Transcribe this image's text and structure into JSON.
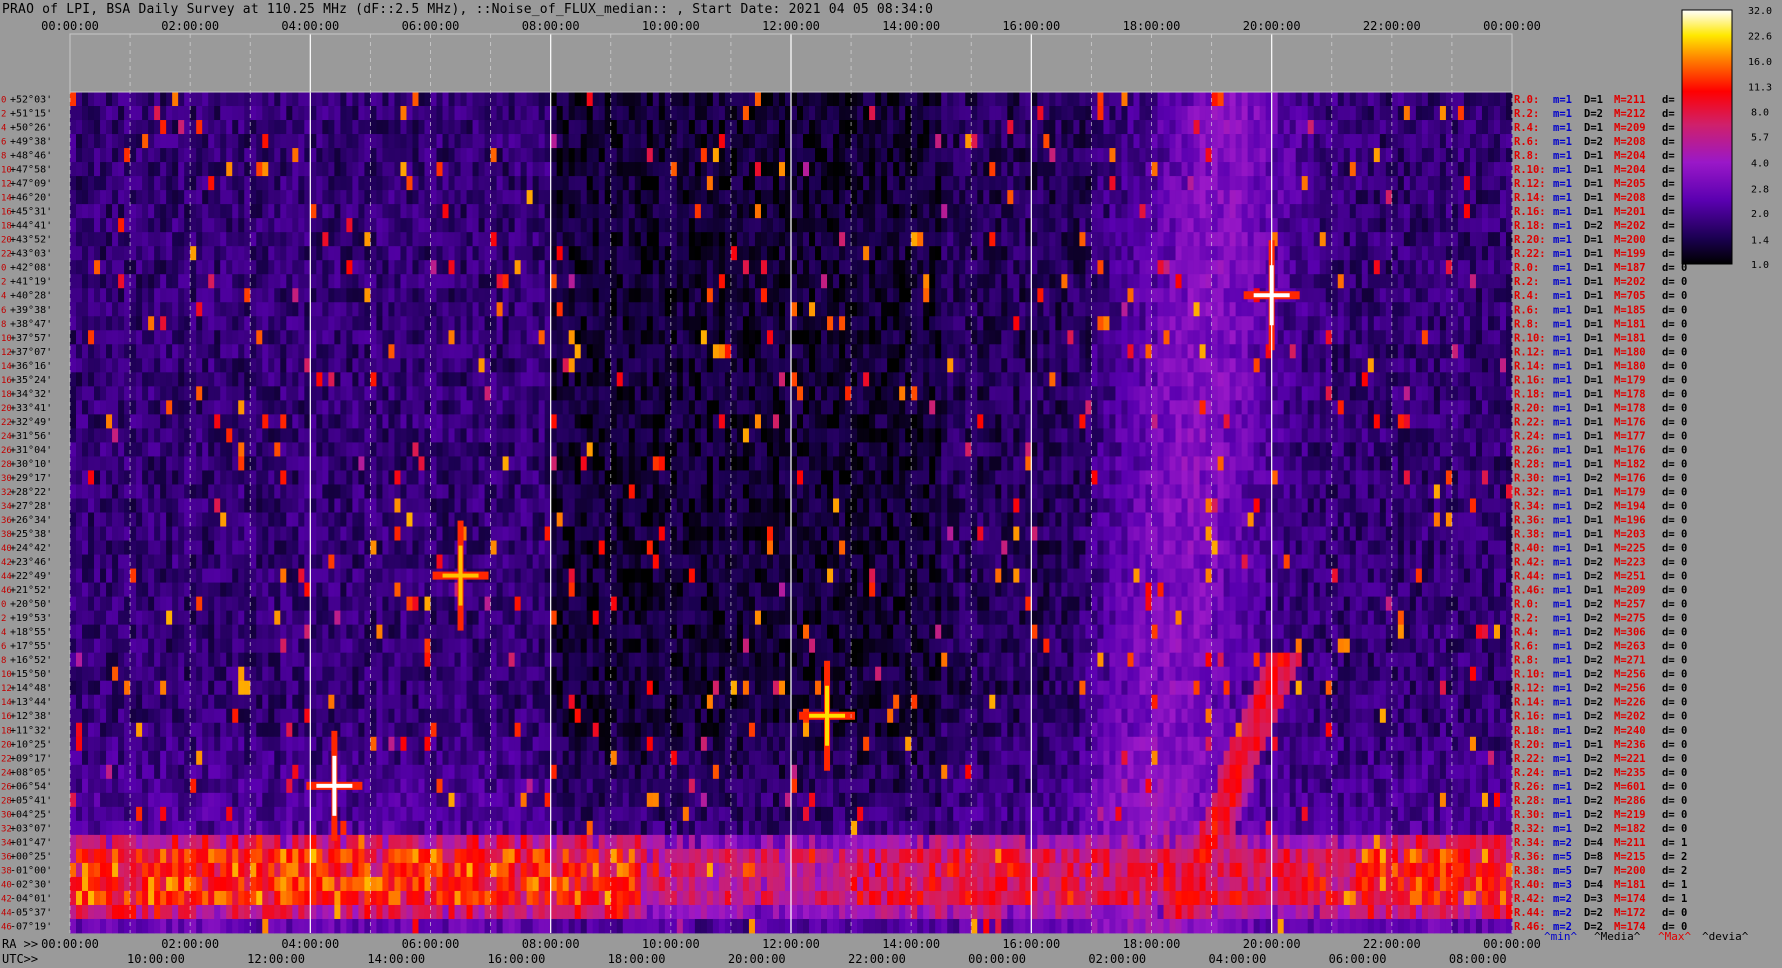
{
  "title": "PRAO of LPI, BSA Daily Survey at 110.25 MHz (dF::2.5 MHz), ::Noise_of_FLUX_median:: , Start Date: 2021 04 05 08:34:0",
  "chart_data": {
    "type": "heatmap",
    "title": "PRAO of LPI, BSA Daily Survey at 110.25 MHz (dF::2.5 MHz), ::Noise_of_FLUX_median:: , Start Date: 2021 04 05 08:34:0",
    "x_axis_top_ticks": [
      "00:00:00",
      "02:00:00",
      "04:00:00",
      "06:00:00",
      "08:00:00",
      "10:00:00",
      "12:00:00",
      "14:00:00",
      "16:00:00",
      "18:00:00",
      "20:00:00",
      "22:00:00",
      "00:00:00"
    ],
    "x_axis_bottom_ra_prefix": "RA >>",
    "x_axis_bottom_ra_ticks": [
      "00:00:00",
      "02:00:00",
      "04:00:00",
      "06:00:00",
      "08:00:00",
      "10:00:00",
      "12:00:00",
      "14:00:00",
      "16:00:00",
      "18:00:00",
      "20:00:00",
      "22:00:00",
      "00:00:00"
    ],
    "x_axis_bottom_utc_prefix": "UTC>>",
    "x_axis_bottom_utc_ticks": [
      "10:00:00",
      "12:00:00",
      "14:00:00",
      "16:00:00",
      "18:00:00",
      "20:00:00",
      "22:00:00",
      "00:00:00",
      "02:00:00",
      "04:00:00",
      "06:00:00",
      "08:00:00"
    ],
    "y_declinations": [
      "+52°03'",
      "+51°15'",
      "+50°26'",
      "+49°38'",
      "+48°46'",
      "+47°58'",
      "+47°09'",
      "+46°20'",
      "+45°31'",
      "+44°41'",
      "+43°52'",
      "+43°03'",
      "+42°08'",
      "+41°19'",
      "+40°28'",
      "+39°38'",
      "+38°47'",
      "+37°57'",
      "+37°07'",
      "+36°16'",
      "+35°24'",
      "+34°32'",
      "+33°41'",
      "+32°49'",
      "+31°56'",
      "+31°04'",
      "+30°10'",
      "+29°17'",
      "+28°22'",
      "+27°28'",
      "+26°34'",
      "+25°38'",
      "+24°42'",
      "+23°46'",
      "+22°49'",
      "+21°52'",
      "+20°50'",
      "+19°53'",
      "+18°55'",
      "+17°55'",
      "+16°52'",
      "+15°50'",
      "+14°48'",
      "+13°44'",
      "+12°38'",
      "+11°32'",
      "+10°25'",
      "+09°17'",
      "+08°05'",
      "+06°54'",
      "+05°41'",
      "+04°25'",
      "+03°07'",
      "+01°47'",
      "+00°25'",
      "-01°00'",
      "-02°30'",
      "-04°01'",
      "-05°37'",
      "-07°19'"
    ],
    "row_numbers": [
      "0",
      "2",
      "4",
      "6",
      "8",
      "10",
      "12",
      "14",
      "16",
      "18",
      "20",
      "22",
      "0",
      "2",
      "4",
      "6",
      "8",
      "10",
      "12",
      "14",
      "16",
      "18",
      "20",
      "22",
      "24",
      "26",
      "28",
      "30",
      "32",
      "34",
      "36",
      "38",
      "40",
      "42",
      "44",
      "46",
      "0",
      "2",
      "4",
      "6",
      "8",
      "10",
      "12",
      "14",
      "16",
      "18",
      "20",
      "22",
      "24",
      "26",
      "28",
      "30",
      "32",
      "34",
      "36",
      "38",
      "40",
      "42",
      "44",
      "46"
    ],
    "right_stats": [
      {
        "r": "R.0:",
        "m": "m=1",
        "d": "D=1",
        "M": "M=211",
        "dd": "d= 0"
      },
      {
        "r": "R.2:",
        "m": "m=1",
        "d": "D=2",
        "M": "M=212",
        "dd": "d= 0"
      },
      {
        "r": "R.4:",
        "m": "m=1",
        "d": "D=1",
        "M": "M=209",
        "dd": "d= 0"
      },
      {
        "r": "R.6:",
        "m": "m=1",
        "d": "D=2",
        "M": "M=208",
        "dd": "d= 0"
      },
      {
        "r": "R.8:",
        "m": "m=1",
        "d": "D=1",
        "M": "M=204",
        "dd": "d= 0"
      },
      {
        "r": "R.10:",
        "m": "m=1",
        "d": "D=1",
        "M": "M=204",
        "dd": "d="
      },
      {
        "r": "R.12:",
        "m": "m=1",
        "d": "D=1",
        "M": "M=205",
        "dd": "d="
      },
      {
        "r": "R.14:",
        "m": "m=1",
        "d": "D=1",
        "M": "M=208",
        "dd": "d="
      },
      {
        "r": "R.16:",
        "m": "m=1",
        "d": "D=1",
        "M": "M=201",
        "dd": "d="
      },
      {
        "r": "R.18:",
        "m": "m=1",
        "d": "D=2",
        "M": "M=202",
        "dd": "d="
      },
      {
        "r": "R.20:",
        "m": "m=1",
        "d": "D=1",
        "M": "M=200",
        "dd": "d="
      },
      {
        "r": "R.22:",
        "m": "m=1",
        "d": "D=1",
        "M": "M=199",
        "dd": "d="
      },
      {
        "r": "R.0:",
        "m": "m=1",
        "d": "D=1",
        "M": "M=187",
        "dd": "d= 0"
      },
      {
        "r": "R.2:",
        "m": "m=1",
        "d": "D=1",
        "M": "M=202",
        "dd": "d= 0"
      },
      {
        "r": "R.4:",
        "m": "m=1",
        "d": "D=1",
        "M": "M=705",
        "dd": "d= 0"
      },
      {
        "r": "R.6:",
        "m": "m=1",
        "d": "D=1",
        "M": "M=185",
        "dd": "d= 0"
      },
      {
        "r": "R.8:",
        "m": "m=1",
        "d": "D=1",
        "M": "M=181",
        "dd": "d= 0"
      },
      {
        "r": "R.10:",
        "m": "m=1",
        "d": "D=1",
        "M": "M=181",
        "dd": "d= 0"
      },
      {
        "r": "R.12:",
        "m": "m=1",
        "d": "D=1",
        "M": "M=180",
        "dd": "d= 0"
      },
      {
        "r": "R.14:",
        "m": "m=1",
        "d": "D=1",
        "M": "M=180",
        "dd": "d= 0"
      },
      {
        "r": "R.16:",
        "m": "m=1",
        "d": "D=1",
        "M": "M=179",
        "dd": "d= 0"
      },
      {
        "r": "R.18:",
        "m": "m=1",
        "d": "D=1",
        "M": "M=178",
        "dd": "d= 0"
      },
      {
        "r": "R.20:",
        "m": "m=1",
        "d": "D=1",
        "M": "M=178",
        "dd": "d= 0"
      },
      {
        "r": "R.22:",
        "m": "m=1",
        "d": "D=1",
        "M": "M=176",
        "dd": "d= 0"
      },
      {
        "r": "R.24:",
        "m": "m=1",
        "d": "D=1",
        "M": "M=177",
        "dd": "d= 0"
      },
      {
        "r": "R.26:",
        "m": "m=1",
        "d": "D=1",
        "M": "M=176",
        "dd": "d= 0"
      },
      {
        "r": "R.28:",
        "m": "m=1",
        "d": "D=1",
        "M": "M=182",
        "dd": "d= 0"
      },
      {
        "r": "R.30:",
        "m": "m=1",
        "d": "D=2",
        "M": "M=176",
        "dd": "d= 0"
      },
      {
        "r": "R.32:",
        "m": "m=1",
        "d": "D=1",
        "M": "M=179",
        "dd": "d= 0"
      },
      {
        "r": "R.34:",
        "m": "m=1",
        "d": "D=2",
        "M": "M=194",
        "dd": "d= 0"
      },
      {
        "r": "R.36:",
        "m": "m=1",
        "d": "D=1",
        "M": "M=196",
        "dd": "d= 0"
      },
      {
        "r": "R.38:",
        "m": "m=1",
        "d": "D=1",
        "M": "M=203",
        "dd": "d= 0"
      },
      {
        "r": "R.40:",
        "m": "m=1",
        "d": "D=1",
        "M": "M=225",
        "dd": "d= 0"
      },
      {
        "r": "R.42:",
        "m": "m=1",
        "d": "D=2",
        "M": "M=223",
        "dd": "d= 0"
      },
      {
        "r": "R.44:",
        "m": "m=1",
        "d": "D=2",
        "M": "M=251",
        "dd": "d= 0"
      },
      {
        "r": "R.46:",
        "m": "m=1",
        "d": "D=1",
        "M": "M=209",
        "dd": "d= 0"
      },
      {
        "r": "R.0:",
        "m": "m=1",
        "d": "D=2",
        "M": "M=257",
        "dd": "d= 0"
      },
      {
        "r": "R.2:",
        "m": "m=1",
        "d": "D=2",
        "M": "M=275",
        "dd": "d= 0"
      },
      {
        "r": "R.4:",
        "m": "m=1",
        "d": "D=2",
        "M": "M=306",
        "dd": "d= 0"
      },
      {
        "r": "R.6:",
        "m": "m=1",
        "d": "D=2",
        "M": "M=263",
        "dd": "d= 0"
      },
      {
        "r": "R.8:",
        "m": "m=1",
        "d": "D=2",
        "M": "M=271",
        "dd": "d= 0"
      },
      {
        "r": "R.10:",
        "m": "m=1",
        "d": "D=2",
        "M": "M=256",
        "dd": "d= 0"
      },
      {
        "r": "R.12:",
        "m": "m=1",
        "d": "D=2",
        "M": "M=256",
        "dd": "d= 0"
      },
      {
        "r": "R.14:",
        "m": "m=1",
        "d": "D=2",
        "M": "M=226",
        "dd": "d= 0"
      },
      {
        "r": "R.16:",
        "m": "m=1",
        "d": "D=2",
        "M": "M=202",
        "dd": "d= 0"
      },
      {
        "r": "R.18:",
        "m": "m=1",
        "d": "D=2",
        "M": "M=240",
        "dd": "d= 0"
      },
      {
        "r": "R.20:",
        "m": "m=1",
        "d": "D=1",
        "M": "M=236",
        "dd": "d= 0"
      },
      {
        "r": "R.22:",
        "m": "m=1",
        "d": "D=2",
        "M": "M=221",
        "dd": "d= 0"
      },
      {
        "r": "R.24:",
        "m": "m=1",
        "d": "D=2",
        "M": "M=235",
        "dd": "d= 0"
      },
      {
        "r": "R.26:",
        "m": "m=1",
        "d": "D=2",
        "M": "M=601",
        "dd": "d= 0"
      },
      {
        "r": "R.28:",
        "m": "m=1",
        "d": "D=2",
        "M": "M=286",
        "dd": "d= 0"
      },
      {
        "r": "R.30:",
        "m": "m=1",
        "d": "D=2",
        "M": "M=219",
        "dd": "d= 0"
      },
      {
        "r": "R.32:",
        "m": "m=1",
        "d": "D=2",
        "M": "M=182",
        "dd": "d= 0"
      },
      {
        "r": "R.34:",
        "m": "m=2",
        "d": "D=4",
        "M": "M=211",
        "dd": "d= 1"
      },
      {
        "r": "R.36:",
        "m": "m=5",
        "d": "D=8",
        "M": "M=215",
        "dd": "d= 2"
      },
      {
        "r": "R.38:",
        "m": "m=5",
        "d": "D=7",
        "M": "M=200",
        "dd": "d= 2"
      },
      {
        "r": "R.40:",
        "m": "m=3",
        "d": "D=4",
        "M": "M=181",
        "dd": "d= 1"
      },
      {
        "r": "R.42:",
        "m": "m=2",
        "d": "D=3",
        "M": "M=174",
        "dd": "d= 1"
      },
      {
        "r": "R.44:",
        "m": "m=2",
        "d": "D=2",
        "M": "M=172",
        "dd": "d= 0"
      },
      {
        "r": "R.46:",
        "m": "m=2",
        "d": "D=2",
        "M": "M=174",
        "dd": "d= 0"
      }
    ],
    "bottom_legend": [
      {
        "text": "^min^",
        "color": "#0000cc"
      },
      {
        "text": "^Media^",
        "color": "#000000"
      },
      {
        "text": "^Max^",
        "color": "#e00000"
      },
      {
        "text": "^devia^",
        "color": "#000000"
      }
    ],
    "colorbar": {
      "ticks": [
        "32.0",
        "22.6",
        "16.0",
        "11.3",
        "8.0",
        "5.7",
        "4.0",
        "2.8",
        "2.0",
        "1.4",
        "1.0"
      ],
      "min": 1.0,
      "max": 32.0,
      "scale": "log",
      "colormap": "gnuplot"
    },
    "features": [
      {
        "name": "bright source",
        "ra_hours": 20.0,
        "row": 14,
        "intensity": 32
      },
      {
        "name": "bright source",
        "ra_hours": 4.4,
        "row": 49,
        "intensity": 32
      },
      {
        "name": "bright source",
        "ra_hours": 6.5,
        "row": 34,
        "intensity": 20
      },
      {
        "name": "bright source",
        "ra_hours": 12.6,
        "row": 44,
        "intensity": 22
      }
    ],
    "equatorial_band_rows": [
      53,
      58
    ],
    "diagonal_emission": {
      "ra_start_hours": 18.5,
      "ra_end_hours": 20.2,
      "row_start": 58,
      "row_end": 40
    }
  }
}
